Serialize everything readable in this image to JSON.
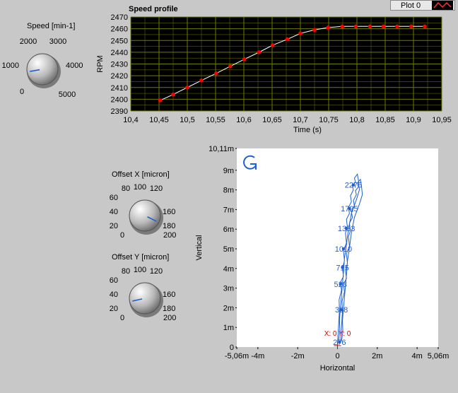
{
  "legend": {
    "label": "Plot 0"
  },
  "speed_knob": {
    "label": "Speed [min-1]",
    "ticks": [
      "0",
      "1000",
      "2000",
      "3000",
      "4000",
      "5000"
    ],
    "value_fraction": 0.13
  },
  "offset_x_knob": {
    "label": "Offset X [micron]",
    "ticks": [
      "0",
      "20",
      "40",
      "60",
      "80",
      "100",
      "120",
      "160",
      "180",
      "200"
    ],
    "value_fraction": 0.93
  },
  "offset_y_knob": {
    "label": "Offset Y [micron]",
    "ticks": [
      "0",
      "20",
      "40",
      "60",
      "80",
      "100",
      "120",
      "160",
      "180",
      "200"
    ],
    "value_fraction": 0.12
  },
  "speed_chart": {
    "title": "Speed profile",
    "xlabel": "Time (s)",
    "ylabel": "RPM",
    "colors": {
      "bg": "#000000",
      "grid": "#6f7a00",
      "line": "#ffffff",
      "marker": "#ff0000"
    },
    "chart_data": {
      "type": "line",
      "title": "Speed profile",
      "xlabel": "Time (s)",
      "ylabel": "RPM",
      "xlim": [
        10.4,
        10.95
      ],
      "ylim": [
        2390,
        2470
      ],
      "xticks": [
        "10,4",
        "10,45",
        "10,5",
        "10,55",
        "10,6",
        "10,65",
        "10,7",
        "10,75",
        "10,8",
        "10,85",
        "10,9",
        "10,95"
      ],
      "yticks": [
        "2390",
        "2400",
        "2410",
        "2420",
        "2430",
        "2440",
        "2450",
        "2460",
        "2470"
      ],
      "grid": true,
      "x": [
        10.452,
        10.475,
        10.5,
        10.525,
        10.551,
        10.576,
        10.601,
        10.627,
        10.651,
        10.677,
        10.7,
        10.725,
        10.749,
        10.774,
        10.798,
        10.823,
        10.847,
        10.871,
        10.896,
        10.92
      ],
      "values": [
        2399,
        2404,
        2410,
        2416,
        2422,
        2428,
        2434,
        2440,
        2446,
        2451,
        2456,
        2459,
        2461,
        2462,
        2462,
        2462,
        2462,
        2462,
        2462,
        2462
      ]
    }
  },
  "xy_chart": {
    "xlabel": "Horizontal",
    "ylabel": "Vertical",
    "cursor_label": "X: 0 Y: 0",
    "colors": {
      "bg": "#ffffff",
      "trace": "#1f5fd0",
      "cursor": "#d00000"
    },
    "chart_data": {
      "type": "line",
      "xlabel": "Horizontal",
      "ylabel": "Vertical",
      "xlim": [
        -5.06,
        5.06
      ],
      "ylim": [
        0,
        10.11
      ],
      "xticks": [
        "-5,06m",
        "-4m",
        "-2m",
        "0",
        "2m",
        "4m",
        "5,06m"
      ],
      "yticks": [
        "0",
        "1m",
        "2m",
        "3m",
        "4m",
        "5m",
        "6m",
        "7m",
        "8m",
        "9m",
        "10,11m"
      ],
      "point_labels": [
        "276",
        "368",
        "528",
        "715",
        "1010",
        "1333",
        "1725",
        "2275"
      ],
      "point_label_positions": [
        [
          0.1,
          0.25
        ],
        [
          0.2,
          1.9
        ],
        [
          0.15,
          3.2
        ],
        [
          0.25,
          4.05
        ],
        [
          0.3,
          5.0
        ],
        [
          0.45,
          6.05
        ],
        [
          0.6,
          7.05
        ],
        [
          0.8,
          8.25
        ]
      ],
      "trace_x": [
        0.0,
        0.05,
        0.1,
        0.08,
        0.2,
        0.15,
        0.3,
        0.25,
        0.35,
        0.3,
        0.45,
        0.4,
        0.5,
        0.45,
        0.6,
        0.55,
        0.7,
        0.65,
        0.8,
        0.75,
        0.9,
        0.85,
        1.0,
        1.05,
        1.1,
        0.95,
        0.7,
        0.55,
        0.45,
        0.35,
        0.3,
        0.25,
        0.2,
        0.15,
        0.1,
        0.12,
        0.05
      ],
      "trace_y": [
        0.2,
        1.0,
        1.9,
        2.4,
        2.9,
        3.3,
        3.6,
        4.0,
        4.4,
        4.9,
        5.3,
        5.8,
        6.1,
        6.5,
        6.8,
        7.1,
        7.4,
        7.7,
        8.0,
        8.2,
        8.4,
        8.6,
        8.8,
        8.5,
        8.0,
        7.5,
        6.8,
        6.0,
        5.2,
        4.5,
        3.8,
        3.2,
        2.6,
        2.0,
        1.4,
        0.8,
        0.3
      ]
    }
  }
}
